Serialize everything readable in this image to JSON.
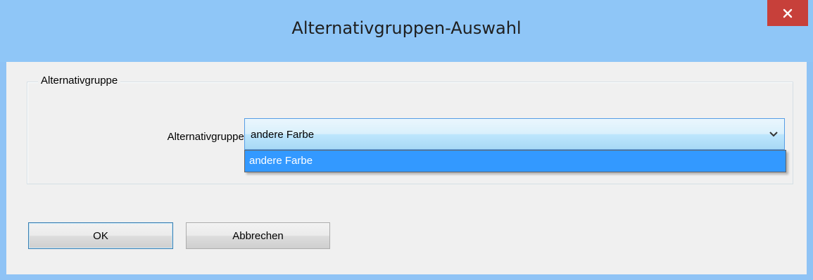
{
  "window": {
    "title": "Alternativgruppen-Auswahl",
    "close_icon": "close-icon"
  },
  "groupbox": {
    "title": "Alternativgruppe"
  },
  "combo": {
    "label": "Alternativgruppe:",
    "value": "andere Farbe",
    "options": [
      "andere Farbe"
    ],
    "highlighted_option": "andere Farbe",
    "arrow_icon": "chevron-down-icon"
  },
  "buttons": {
    "ok_label": "OK",
    "cancel_label": "Abbrechen"
  },
  "colors": {
    "titlebar": "#8fc6f7",
    "close_button": "#c7403a",
    "selection": "#3399ff",
    "dialog_background": "#f0f0f0"
  }
}
